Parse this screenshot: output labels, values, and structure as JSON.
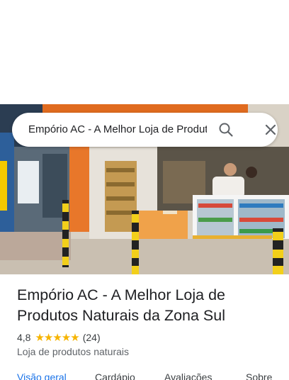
{
  "search": {
    "query": "Empório AC - A Melhor Loja de Produtos Naturais da Zona Sul"
  },
  "place": {
    "title": "Empório AC - A Melhor Loja de Produtos Naturais da Zona Sul",
    "rating": "4,8",
    "stars": "★★★★★",
    "review_count": "(24)",
    "category": "Loja de produtos naturais"
  },
  "tabs": [
    {
      "label": "Visão geral",
      "active": true
    },
    {
      "label": "Cardápio",
      "active": false
    },
    {
      "label": "Avaliações",
      "active": false
    },
    {
      "label": "Sobre",
      "active": false
    }
  ],
  "colors": {
    "accent": "#1a73e8",
    "star": "#f6b400",
    "text": "#202124"
  },
  "icons": {
    "search": "search-icon",
    "close": "close-icon"
  }
}
